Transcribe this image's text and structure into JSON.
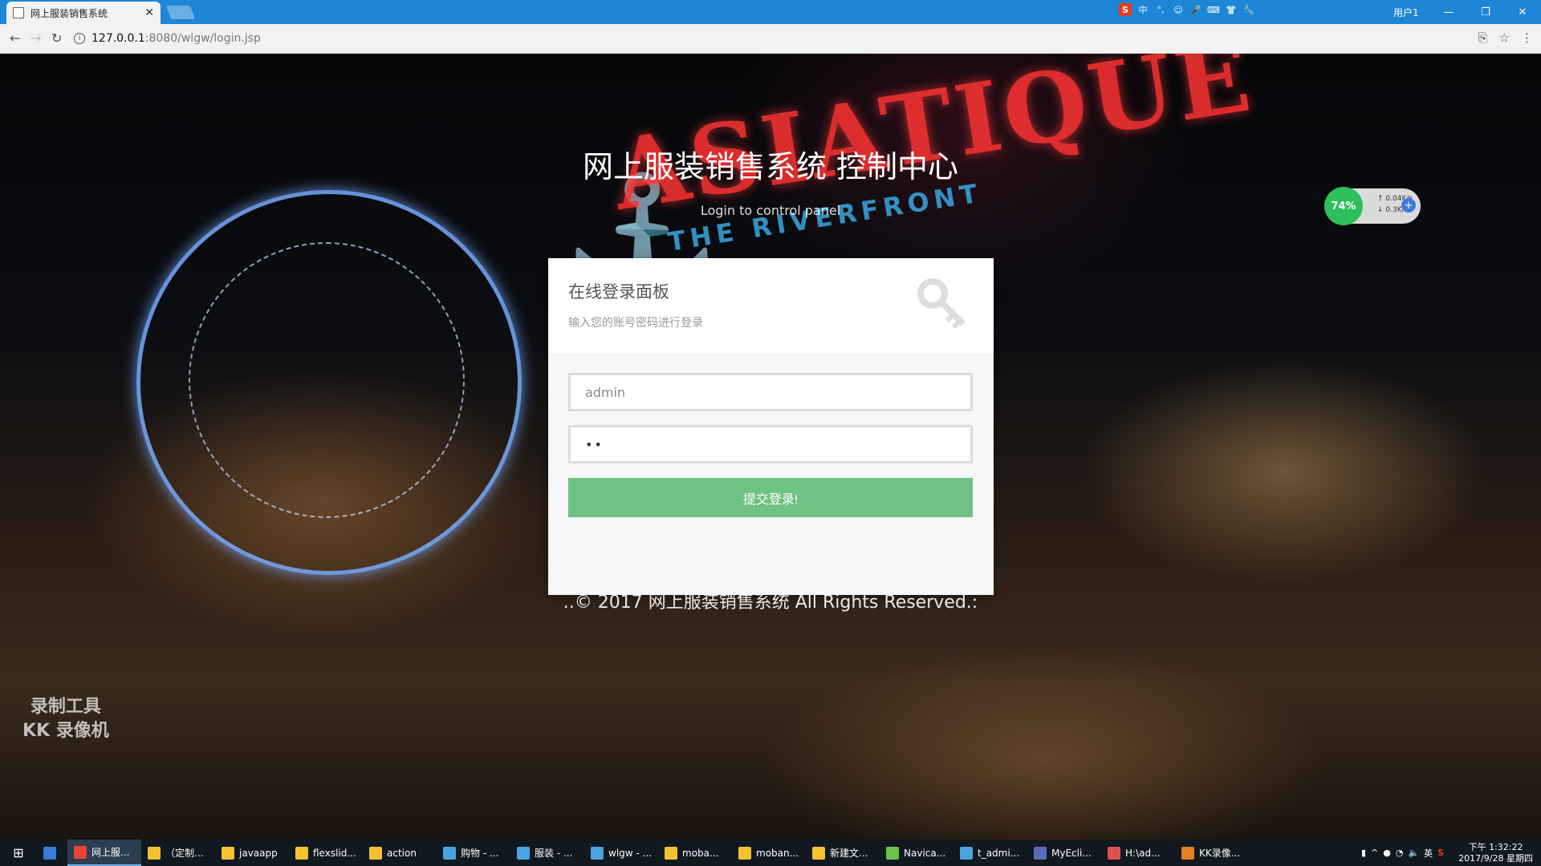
{
  "browser": {
    "tab_title": "网上服装销售系统",
    "url_host": "127.0.0.1",
    "url_path": ":8080/wlgw/login.jsp",
    "user_label": "用户1",
    "ime_items": [
      "S",
      "中",
      "°,",
      "☺",
      "🎤",
      "⌨",
      "👕",
      "🔧"
    ]
  },
  "page": {
    "title": "网上服装销售系统 控制中心",
    "subtitle": "Login to control panel",
    "background_sign": "ASIATIQUE",
    "background_sign_sub": "THE RIVERFRONT",
    "watermark_line1": "录制工具",
    "watermark_line2": "KK 录像机",
    "footer": "..© 2017 网上服装销售系统 All Rights Reserved.:"
  },
  "login": {
    "panel_title": "在线登录面板",
    "panel_desc": "输入您的账号密码进行登录",
    "username_value": "admin",
    "password_value": "••",
    "submit_label": "提交登录!"
  },
  "net_widget": {
    "percent": "74%",
    "up": "0.04K/s",
    "down": "0.3K/s"
  },
  "taskbar": {
    "items": [
      {
        "label": "网上服...",
        "color": "#e94335"
      },
      {
        "label": "（定制...",
        "color": "#f2c230"
      },
      {
        "label": "javaapp",
        "color": "#f2c230"
      },
      {
        "label": "flexslid...",
        "color": "#f2c230"
      },
      {
        "label": "action",
        "color": "#f2c230"
      },
      {
        "label": "购物 - ...",
        "color": "#4aa3df"
      },
      {
        "label": "服装 - ...",
        "color": "#4aa3df"
      },
      {
        "label": "wlgw - ...",
        "color": "#4aa3df"
      },
      {
        "label": "moba...",
        "color": "#f2c230"
      },
      {
        "label": "moban...",
        "color": "#f2c230"
      },
      {
        "label": "新建文...",
        "color": "#f2c230"
      },
      {
        "label": "Navica...",
        "color": "#6cc24a"
      },
      {
        "label": "t_admi...",
        "color": "#4aa3df"
      },
      {
        "label": "MyEcli...",
        "color": "#5b6ab8"
      },
      {
        "label": "H:\\ad...",
        "color": "#d9534f"
      },
      {
        "label": "KK录像...",
        "color": "#e67e22"
      }
    ],
    "tray_lang": "英",
    "time": "下午 1:32:22",
    "date": "2017/9/28 星期四"
  }
}
